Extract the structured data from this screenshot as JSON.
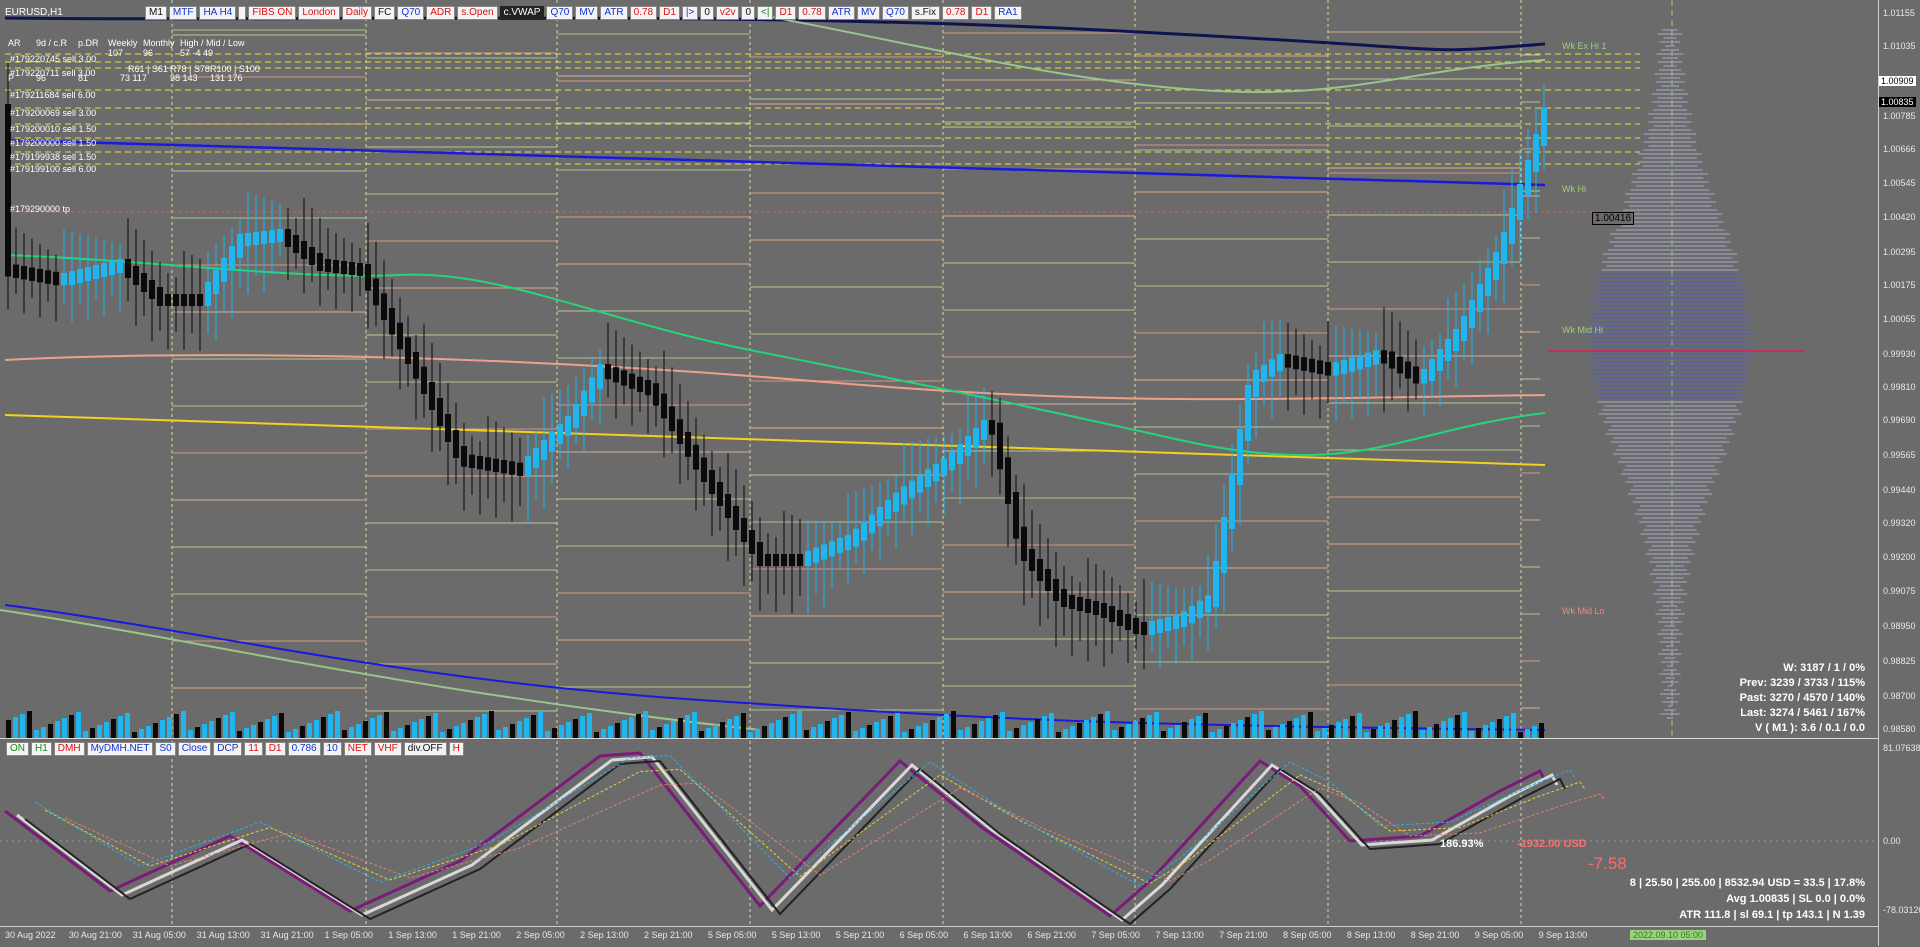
{
  "symbol": "EURUSD,H1",
  "top_toolbar": [
    "M1",
    "MTF",
    "HA H4",
    "",
    "FIBS ON",
    "London",
    "Daily",
    "FC",
    "Q70",
    "ADR",
    "s.Open",
    "c.VWAP",
    "Q70",
    "MV",
    "ATR",
    "0.78",
    "D1",
    "|>",
    "0",
    "v2v",
    "0",
    "<|",
    "D1",
    "0.78",
    "ATR",
    "MV",
    "Q70",
    "s.Fix",
    "0.78",
    "D1",
    "RA1"
  ],
  "bottom_toolbar": [
    "ON",
    "H1",
    "DMH",
    "MyDMH.NET",
    "S0",
    "Close",
    "DCP",
    "11",
    "D1",
    "0.786",
    "10",
    "NET",
    "VHF",
    "div.OFF",
    "H"
  ],
  "info_table": {
    "headers": [
      "AR",
      "9d / c.R",
      "p.DR",
      "Weekly",
      "Monthly",
      "High / Mid / Low"
    ],
    "row1": [
      "",
      "",
      "",
      "107",
      "96",
      "57  -4  49"
    ],
    "row2_labels": [
      "R61 | S61",
      "R78 | S78",
      "R100 | S100"
    ],
    "row3": [
      "P",
      "96",
      "81",
      "73  117",
      "98  143",
      "131  176"
    ]
  },
  "orders": [
    "#179220745 sell 3.00",
    "#179220711 sell 3.00",
    "#179211684 sell 6.00",
    "#179200069 sell 3.00",
    "#179200010 sell 1.50",
    "#179200000 sell 1.50",
    "#179199938 sell 1.50",
    "#179199100 sell 6.00",
    "#179290000 tp"
  ],
  "price_axis": [
    "1.01155",
    "1.01035",
    "1.00909",
    "1.00835",
    "1.00785",
    "1.00666",
    "1.00545",
    "1.00420",
    "1.00295",
    "1.00175",
    "1.00055",
    "0.99930",
    "0.99810",
    "0.99690",
    "0.99565",
    "0.99440",
    "0.99320",
    "0.99200",
    "0.99075",
    "0.98950",
    "0.98825",
    "0.98700",
    "0.98580"
  ],
  "price_highlight": "1.00835",
  "price_current": "1.00909",
  "price_marker": "1.00416",
  "osc_axis": [
    "81.07638",
    "0.00",
    "-78.03120"
  ],
  "time_axis": [
    "30 Aug 2022",
    "30 Aug 21:00",
    "31 Aug 05:00",
    "31 Aug 13:00",
    "31 Aug 21:00",
    "1 Sep 05:00",
    "1 Sep 13:00",
    "1 Sep 21:00",
    "2 Sep 05:00",
    "2 Sep 13:00",
    "2 Sep 21:00",
    "5 Sep 05:00",
    "5 Sep 13:00",
    "5 Sep 21:00",
    "6 Sep 05:00",
    "6 Sep 13:00",
    "6 Sep 21:00",
    "7 Sep 05:00",
    "7 Sep 13:00",
    "7 Sep 21:00",
    "8 Sep 05:00",
    "8 Sep 13:00",
    "8 Sep 21:00",
    "9 Sep 05:00",
    "9 Sep 13:00"
  ],
  "time_highlight": "2022.09.10 05:00",
  "volume_stats": [
    "W: 3187 / 1 / 0%",
    "Prev: 3239 / 3733 / 115%",
    "Past: 3270 / 4570 / 140%",
    "Last: 3274 / 5461 / 167%",
    "V ( M1 ): 3.6 / 0.1 / 0.0"
  ],
  "account": {
    "pct": "186.93%",
    "usd": "-1932.00 USD",
    "pips": "-7.58",
    "line1": "8  |  25.50  |  255.00  |  8532.94 USD = 33.5  |  17.8%",
    "line2": "Avg 1.00835  |  SL 0.0  |  0.0%",
    "line3": "ATR 111.8  |  sl 69.1  |  tp 143.1  |  N 1.39"
  },
  "week_labels": [
    "Wk Ex Hi 1",
    "Wk Hi",
    "Wk Mid Hi",
    "Wk Mid Lo"
  ],
  "colors": {
    "up": "#1fb5ef",
    "down": "#0a0a0a",
    "bg": "#6b6b6b",
    "ma_green": "#27d47a",
    "ma_salmon": "#f0a088",
    "ma_yellow": "#f2d21a",
    "ma_blue": "#1a1adc",
    "ma_navy": "#0e1450"
  }
}
